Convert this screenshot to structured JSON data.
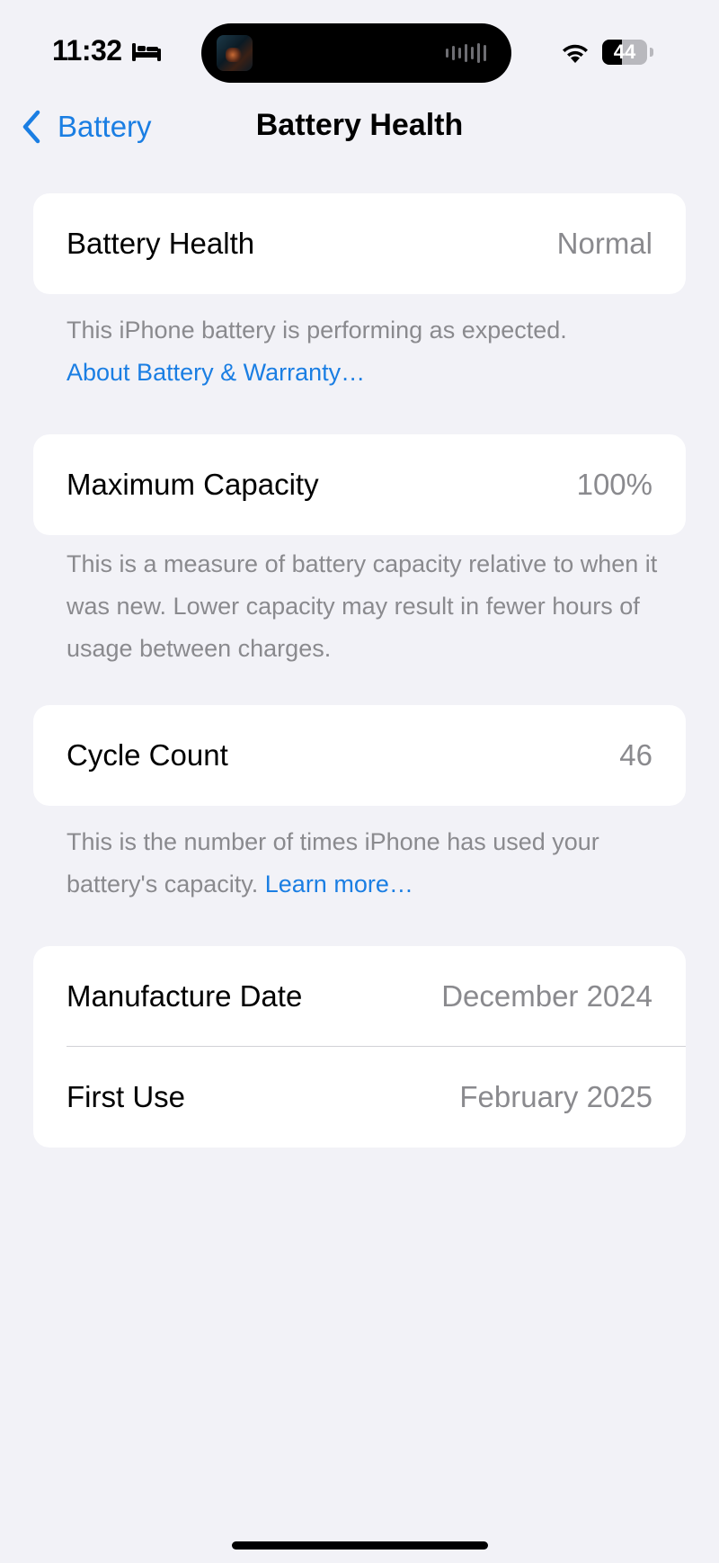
{
  "status_bar": {
    "time": "11:32",
    "focus_icon": "bed-icon",
    "battery_level": "44",
    "battery_fraction": 0.44
  },
  "nav": {
    "back_label": "Battery",
    "title": "Battery Health"
  },
  "sections": {
    "health": {
      "label": "Battery Health",
      "value": "Normal",
      "footer_text": "This iPhone battery is performing as expected.",
      "footer_link": "About Battery & Warranty…"
    },
    "capacity": {
      "label": "Maximum Capacity",
      "value": "100%",
      "footer_text": "This is a measure of battery capacity relative to when it was new. Lower capacity may result in fewer hours of usage between charges."
    },
    "cycles": {
      "label": "Cycle Count",
      "value": "46",
      "footer_text": "This is the number of times iPhone has used your battery's capacity.",
      "footer_link": "Learn more…"
    },
    "dates": {
      "manufacture_label": "Manufacture Date",
      "manufacture_value": "December 2024",
      "first_use_label": "First Use",
      "first_use_value": "February 2025"
    }
  },
  "colors": {
    "accent": "#1a7ee3",
    "background": "#f2f2f7",
    "secondary_text": "#8a8a8e"
  }
}
